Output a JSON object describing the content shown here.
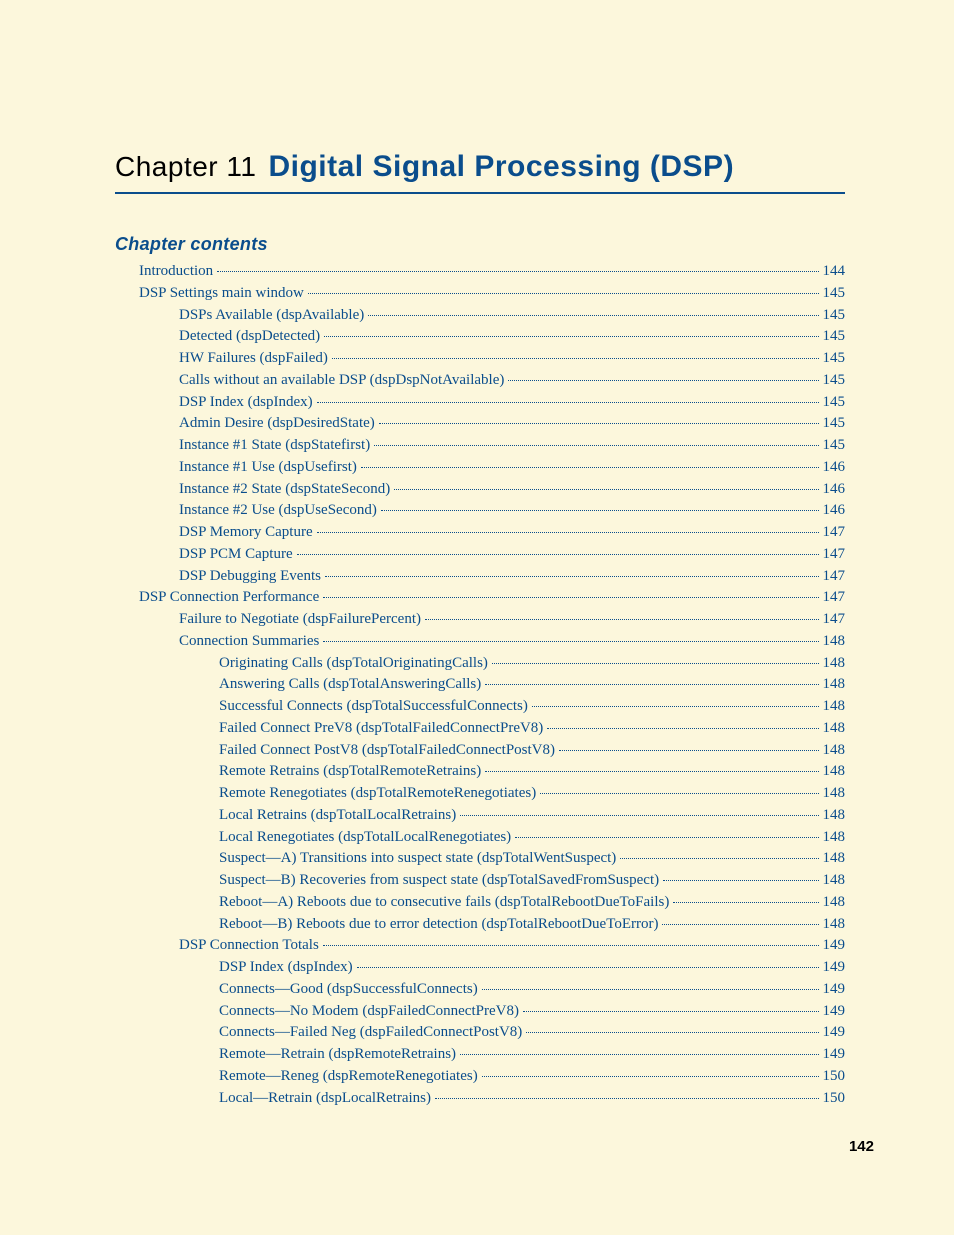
{
  "chapter_label": "Chapter 11",
  "chapter_title": "Digital Signal Processing (DSP)",
  "contents_heading": "Chapter contents",
  "page_number": "142",
  "toc": [
    {
      "label": "Introduction",
      "page": "144",
      "indent": 1
    },
    {
      "label": "DSP Settings main window",
      "page": "145",
      "indent": 1
    },
    {
      "label": "DSPs Available (dspAvailable) ",
      "page": "145",
      "indent": 2
    },
    {
      "label": "Detected (dspDetected) ",
      "page": "145",
      "indent": 2
    },
    {
      "label": "HW Failures (dspFailed) ",
      "page": "145",
      "indent": 2
    },
    {
      "label": "Calls without an available DSP (dspDspNotAvailable) ",
      "page": "145",
      "indent": 2
    },
    {
      "label": "DSP Index (dspIndex) ",
      "page": "145",
      "indent": 2
    },
    {
      "label": "Admin Desire (dspDesiredState) ",
      "page": "145",
      "indent": 2
    },
    {
      "label": "Instance #1 State (dspStatefirst) ",
      "page": "145",
      "indent": 2
    },
    {
      "label": "Instance #1 Use (dspUsefirst) ",
      "page": "146",
      "indent": 2
    },
    {
      "label": "Instance #2 State (dspStateSecond) ",
      "page": "146",
      "indent": 2
    },
    {
      "label": "Instance #2 Use (dspUseSecond) ",
      "page": "146",
      "indent": 2
    },
    {
      "label": "DSP Memory Capture ",
      "page": "147",
      "indent": 2
    },
    {
      "label": "DSP PCM Capture ",
      "page": "147",
      "indent": 2
    },
    {
      "label": "DSP Debugging Events ",
      "page": "147",
      "indent": 2
    },
    {
      "label": "DSP Connection Performance",
      "page": "147",
      "indent": 1
    },
    {
      "label": "Failure to Negotiate (dspFailurePercent) ",
      "page": "147",
      "indent": 2
    },
    {
      "label": "Connection Summaries ",
      "page": "148",
      "indent": 2
    },
    {
      "label": "Originating Calls (dspTotalOriginatingCalls) ",
      "page": "148",
      "indent": 3
    },
    {
      "label": "Answering Calls (dspTotalAnsweringCalls) ",
      "page": "148",
      "indent": 3
    },
    {
      "label": "Successful Connects (dspTotalSuccessfulConnects) ",
      "page": "148",
      "indent": 3
    },
    {
      "label": "Failed Connect PreV8 (dspTotalFailedConnectPreV8) ",
      "page": "148",
      "indent": 3
    },
    {
      "label": "Failed Connect PostV8 (dspTotalFailedConnectPostV8) ",
      "page": "148",
      "indent": 3
    },
    {
      "label": "Remote Retrains (dspTotalRemoteRetrains) ",
      "page": "148",
      "indent": 3
    },
    {
      "label": "Remote Renegotiates (dspTotalRemoteRenegotiates) ",
      "page": "148",
      "indent": 3
    },
    {
      "label": "Local Retrains (dspTotalLocalRetrains) ",
      "page": "148",
      "indent": 3
    },
    {
      "label": "Local Renegotiates (dspTotalLocalRenegotiates) ",
      "page": "148",
      "indent": 3
    },
    {
      "label": "Suspect—A) Transitions into suspect state (dspTotalWentSuspect) ",
      "page": "148",
      "indent": 3
    },
    {
      "label": "Suspect—B) Recoveries from suspect state (dspTotalSavedFromSuspect) ",
      "page": "148",
      "indent": 3
    },
    {
      "label": "Reboot—A) Reboots due to consecutive fails (dspTotalRebootDueToFails) ",
      "page": "148",
      "indent": 3
    },
    {
      "label": "Reboot—B) Reboots due to error detection (dspTotalRebootDueToError) ",
      "page": "148",
      "indent": 3
    },
    {
      "label": "DSP Connection Totals ",
      "page": "149",
      "indent": 2
    },
    {
      "label": "DSP Index (dspIndex) ",
      "page": "149",
      "indent": 3
    },
    {
      "label": "Connects—Good (dspSuccessfulConnects) ",
      "page": "149",
      "indent": 3
    },
    {
      "label": "Connects—No Modem (dspFailedConnectPreV8) ",
      "page": "149",
      "indent": 3
    },
    {
      "label": "Connects—Failed Neg (dspFailedConnectPostV8) ",
      "page": "149",
      "indent": 3
    },
    {
      "label": "Remote—Retrain (dspRemoteRetrains) ",
      "page": "149",
      "indent": 3
    },
    {
      "label": "Remote—Reneg (dspRemoteRenegotiates) ",
      "page": "150",
      "indent": 3
    },
    {
      "label": "Local—Retrain (dspLocalRetrains) ",
      "page": "150",
      "indent": 3
    }
  ]
}
